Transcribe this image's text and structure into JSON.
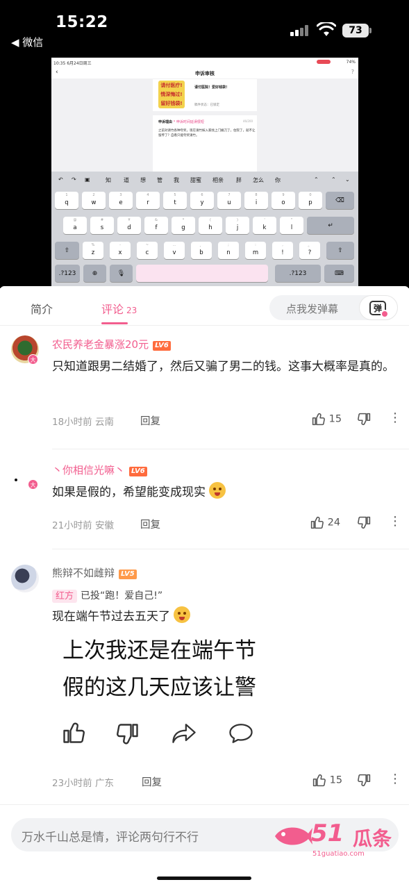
{
  "status_bar": {
    "time": "15:22",
    "back_app": "◀ 微信",
    "battery": "73"
  },
  "tablet": {
    "status_left": "10:35  6月24日周三",
    "status_right": "74%",
    "page_title": "申诉审核",
    "stickers": [
      "请付医疗!",
      "情深悔过!",
      "留好钱袋!"
    ],
    "card1_title": "请付医院！爱好钱袋！",
    "card1_status": "稿件状态：已锁定",
    "reason_label": "申诉理由",
    "reason_hint": "*  申诉时间延误很短",
    "reason_count": "46/200",
    "reason_body": "之前对请竹各种夸奖，现在请竹嫁入家找上门捅刀了，住院了，就不让留传了？自看只能夸奖请竹。",
    "candidates": [
      "知",
      "道",
      "想",
      "管",
      "我",
      "甜蜜",
      "相亲",
      "胖",
      "怎么",
      "你"
    ],
    "row1": [
      [
        "q",
        "1"
      ],
      [
        "w",
        "2"
      ],
      [
        "e",
        "3"
      ],
      [
        "r",
        "4"
      ],
      [
        "t",
        "5"
      ],
      [
        "y",
        "6"
      ],
      [
        "u",
        "7"
      ],
      [
        "i",
        "8"
      ],
      [
        "o",
        "9"
      ],
      [
        "p",
        "0"
      ]
    ],
    "row2": [
      [
        "a",
        "@"
      ],
      [
        "s",
        "#"
      ],
      [
        "d",
        "¥"
      ],
      [
        "f",
        "&"
      ],
      [
        "g",
        "*"
      ],
      [
        "h",
        "("
      ],
      [
        "j",
        ")"
      ],
      [
        "k",
        "'"
      ],
      [
        "l",
        "\""
      ]
    ],
    "row3": [
      [
        "z",
        "%"
      ],
      [
        "x",
        "-"
      ],
      [
        "c",
        "~"
      ],
      [
        "v",
        "…"
      ],
      [
        "b",
        "、"
      ],
      [
        "n",
        ";"
      ],
      [
        "m",
        ":"
      ],
      [
        "!",
        ","
      ],
      [
        "?",
        "。"
      ]
    ],
    "key_123": ".?123"
  },
  "tabs": {
    "intro": "简介",
    "comments": "评论",
    "comments_count": "23",
    "danmaku_placeholder": "点我发弹幕",
    "danmaku_button": "弹"
  },
  "comments": [
    {
      "username": "农民养老金暴涨20元",
      "level": "LV6",
      "username_color": "#f25d8e",
      "text": "只知道跟男二结婚了，然后又骗了男二的钱。这事大概率是真的。",
      "time": "18小时前",
      "location": "云南",
      "reply": "回复",
      "likes": "15"
    },
    {
      "username": "丶你相信光嘛丶",
      "level": "LV6",
      "username_color": "#f25d8e",
      "text": "如果是假的，希望能变成现实",
      "time": "21小时前",
      "location": "安徽",
      "reply": "回复",
      "likes": "24"
    },
    {
      "username": "熊辩不如雌辩",
      "level": "LV5",
      "username_color": "#666666",
      "vote_side": "红方",
      "vote_text": "已投“跑！爱自己!”",
      "text": "现在端午节过去五天了",
      "image_lines": [
        "上次我还是在端午节",
        "假的这几天应该让警"
      ],
      "time": "23小时前",
      "location": "广东",
      "reply": "回复",
      "likes": "15"
    }
  ],
  "bottom": {
    "placeholder": "万水千山总是情，评论两句行不行",
    "watermark_num": "51",
    "watermark_name": "瓜条",
    "watermark_url": "51guatiao.com"
  },
  "colors": {
    "accent": "#f25d8e",
    "lv6": "#ff6b3d",
    "lv5": "#ff9a4a"
  }
}
